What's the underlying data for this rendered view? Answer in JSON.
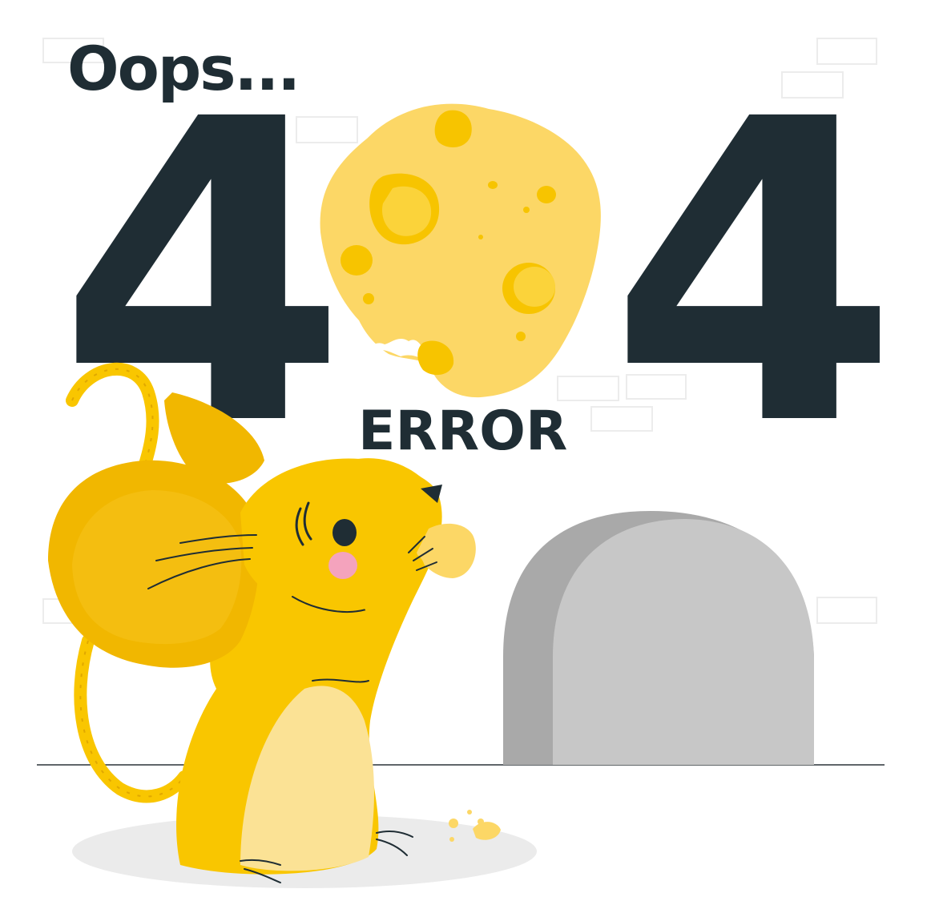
{
  "headline": "Oops...",
  "code_left_digit": "4",
  "code_right_digit": "4",
  "subtitle": "ERROR",
  "illustration": {
    "zero_replacement": "cheese-wheel",
    "character": "yellow-mouse-eating-cheese",
    "background_object": "mouse-hole"
  },
  "colors": {
    "text": "#1f2d34",
    "cheese": "#fcd766",
    "cheese_holes": "#f7c400",
    "mouse_body": "#f9c600",
    "mouse_belly": "#fbe295",
    "hole": "#c7c7c7",
    "hole_shadow": "#a9a9a9",
    "cheek": "#f4a3bd"
  }
}
